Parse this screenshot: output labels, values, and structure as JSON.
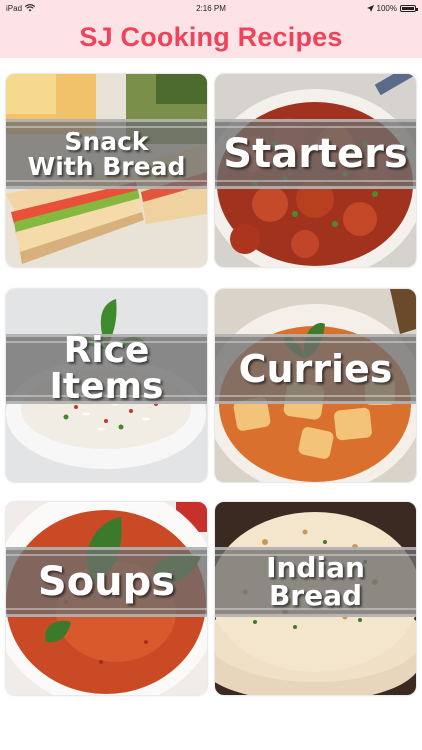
{
  "status_bar": {
    "device": "iPad",
    "time": "2:16 PM",
    "battery": "100%",
    "battery_level": 1.0
  },
  "header": {
    "title": "SJ Cooking Recipes"
  },
  "tiles": [
    {
      "label": "Snack\nWith Bread"
    },
    {
      "label": "Starters"
    },
    {
      "label": "Rice Items"
    },
    {
      "label": "Curries"
    },
    {
      "label": "Soups"
    },
    {
      "label": "Indian Bread"
    }
  ],
  "colors": {
    "header_bg": "#fde3e5",
    "title": "#f0435a",
    "band": "#6e6e6e"
  }
}
